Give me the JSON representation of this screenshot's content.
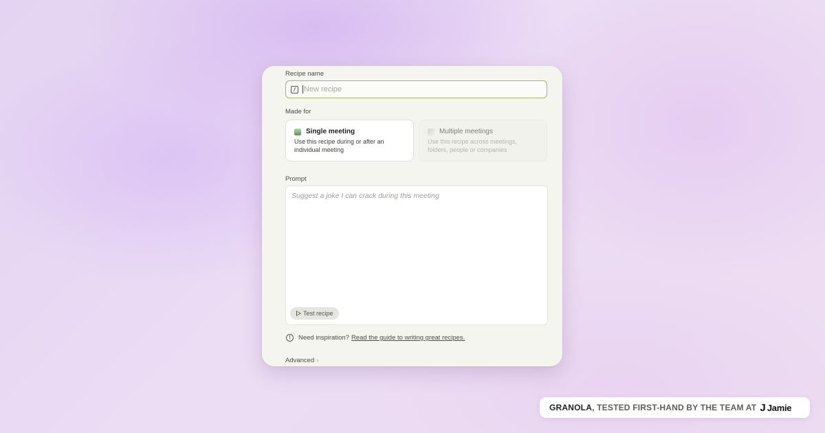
{
  "form": {
    "recipe_name_label": "Recipe name",
    "recipe_name_placeholder": "New recipe",
    "made_for_label": "Made for",
    "options": [
      {
        "title": "Single meeting",
        "desc_line1": "Use this recipe during or after an",
        "desc_line2": "individual meeting",
        "selected": true
      },
      {
        "title": "Multiple meetings",
        "desc_line1": "Use this recipe across meetings,",
        "desc_line2": "folders, people or companies",
        "selected": false
      }
    ],
    "prompt_label": "Prompt",
    "prompt_placeholder": "Suggest a joke I can crack during this meeting",
    "test_button_label": "Test recipe",
    "inspiration_text": "Need inspiration?",
    "inspiration_link": "Read the guide to writing great recipes.",
    "advanced_label": "Advanced",
    "advanced_chevron": "›"
  },
  "footer": {
    "brand": "GRANOLA",
    "tagline": ", TESTED FIRST-HAND BY THE TEAM AT",
    "logo_mark": "J",
    "logo_name": "Jamie"
  },
  "icons": {
    "name_field": "edit-icon",
    "test_button": "play-icon",
    "inspiration": "info-icon",
    "advanced": "chevron-right-icon"
  },
  "colors": {
    "focus_border": "#a6b56a",
    "selected_check": "#5c8f57",
    "card_bg": "#f5f5f0"
  }
}
